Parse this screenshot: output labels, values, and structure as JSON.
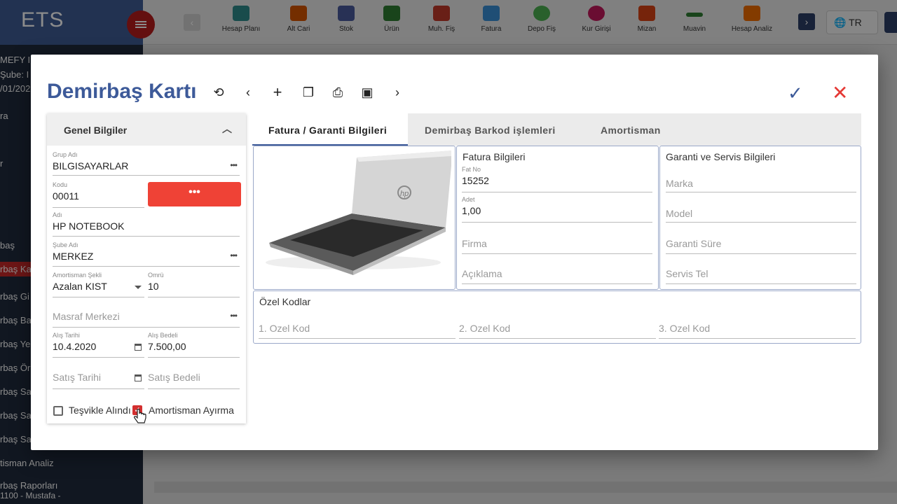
{
  "app": {
    "brand": "ETS",
    "lang": "TR",
    "toolbar": [
      {
        "label": "Hesap Planı",
        "color": "#2e8b8b"
      },
      {
        "label": "Alt Cari",
        "color": "#d35400"
      },
      {
        "label": "Stok",
        "color": "#4a5a9b"
      },
      {
        "label": "Ürün",
        "color": "#2e7d32"
      },
      {
        "label": "Muh. Fiş",
        "color": "#c0392b"
      },
      {
        "label": "Fatura",
        "color": "#3a8fd6"
      },
      {
        "label": "Depo Fiş",
        "color": "#4caf50"
      },
      {
        "label": "Kur Girişi",
        "color": "#c2185b"
      },
      {
        "label": "Mizan",
        "color": "#d84315"
      },
      {
        "label": "Muavin",
        "color": "#2e7d32"
      },
      {
        "label": "Hesap Analiz",
        "color": "#ef6c00"
      }
    ],
    "sidebar": {
      "company_lines": [
        "MEFY I",
        "Şube: I",
        "/01/202"
      ],
      "items": [
        "ra",
        "r",
        "baş",
        "rbaş Ka",
        "rbaş Gi",
        "rbaş Ba",
        "rbaş Ye",
        "rbaş Ör",
        "rbaş Sa",
        "rbaş Sa",
        "rbaş Sa",
        "tisman Analiz",
        "rbaş Raporları"
      ],
      "footer": "1100 - Mustafa -"
    }
  },
  "modal": {
    "title": "Demirbaş Kartı",
    "toolbar_icons": [
      "history-icon",
      "chevron-left-icon",
      "plus-icon",
      "copy-icon",
      "print-icon",
      "save-icon",
      "chevron-right-icon"
    ],
    "left_panel": {
      "header": "Genel Bilgiler",
      "grup_adi": {
        "label": "Grup Adı",
        "value": "BILGISAYARLAR"
      },
      "kodu": {
        "label": "Kodu",
        "value": "00011"
      },
      "code_button": "•••",
      "adi": {
        "label": "Adı",
        "value": "HP NOTEBOOK"
      },
      "sube_adi": {
        "label": "Şube Adı",
        "value": "MERKEZ"
      },
      "amortisman_sekli": {
        "label": "Amortisman Şekli",
        "value": "Azalan KIST"
      },
      "omru": {
        "label": "Omrü",
        "value": "10"
      },
      "masraf_merkezi": {
        "placeholder": "Masraf Merkezi"
      },
      "alis_tarihi": {
        "label": "Alış Tarihi",
        "value": "10.4.2020"
      },
      "alis_bedeli": {
        "label": "Alış Bedeli",
        "value": "7.500,00"
      },
      "satis_tarihi": {
        "placeholder": "Satış Tarihi"
      },
      "satis_bedeli": {
        "placeholder": "Satış Bedeli"
      },
      "tesvik": {
        "label": "Teşvikle Alındı",
        "checked": false
      },
      "amortisman_ayirma": {
        "label": "Amortisman Ayırma",
        "checked": true
      }
    },
    "tabs": [
      "Fatura / Garanti Bilgileri",
      "Demirbaş Barkod işlemleri",
      "Amortisman"
    ],
    "fatura": {
      "title": "Fatura Bilgileri",
      "fat_no": {
        "label": "Fat No",
        "value": "15252"
      },
      "adet": {
        "label": "Adet",
        "value": "1,00"
      },
      "firma": {
        "placeholder": "Firma"
      },
      "aciklama": {
        "placeholder": "Açıklama"
      }
    },
    "garanti": {
      "title": "Garanti ve Servis Bilgileri",
      "marka": {
        "placeholder": "Marka"
      },
      "model": {
        "placeholder": "Model"
      },
      "garanti_sure": {
        "placeholder": "Garanti Süre"
      },
      "servis_tel": {
        "placeholder": "Servis Tel"
      }
    },
    "ozel_kodlar": {
      "title": "Özel Kodlar",
      "kod1": {
        "placeholder": "1. Ozel Kod"
      },
      "kod2": {
        "placeholder": "2. Ozel Kod"
      },
      "kod3": {
        "placeholder": "3. Ozel Kod"
      }
    }
  }
}
